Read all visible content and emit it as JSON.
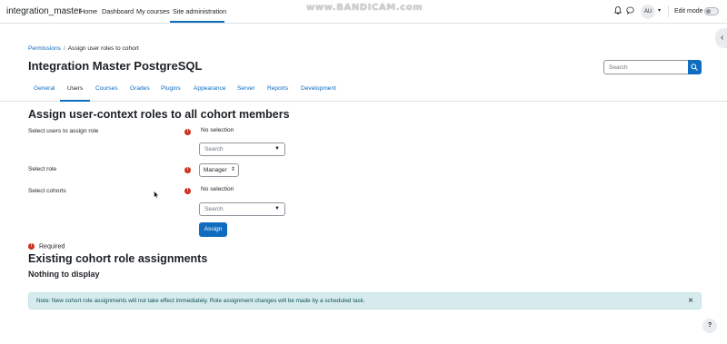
{
  "navbar": {
    "site_name": "integration_master",
    "items": [
      "Home",
      "Dashboard",
      "My courses",
      "Site administration"
    ],
    "watermark": "www.BANDICAM.com",
    "avatar_initials": "AU",
    "edit_mode_label": "Edit mode"
  },
  "breadcrumb": {
    "link": "Permissions",
    "separator": "/",
    "current": "Assign user roles to cohort"
  },
  "header": {
    "title": "Integration Master PostgreSQL",
    "search_placeholder": "Search"
  },
  "tabs": [
    "General",
    "Users",
    "Courses",
    "Grades",
    "Plugins",
    "Appearance",
    "Server",
    "Reports",
    "Development"
  ],
  "active_tab": "Users",
  "form": {
    "heading": "Assign user-context roles to all cohort members",
    "users_label": "Select users to assign role",
    "users_value": "No selection",
    "users_search": "Search",
    "role_label": "Select role",
    "role_value": "Manager",
    "cohorts_label": "Select cohorts",
    "cohorts_value": "No selection",
    "cohorts_search": "Search",
    "assign_button": "Assign",
    "required_note": "Required"
  },
  "assignments": {
    "heading": "Existing cohort role assignments",
    "empty": "Nothing to display"
  },
  "alert": {
    "text": "Note: New cohort role assignments will not take effect immediately. Role assignment changes will be made by a scheduled task."
  },
  "help_label": "?",
  "colors": {
    "primary": "#0f6cbf",
    "danger": "#ca3120",
    "info_bg": "#d6ebed"
  }
}
